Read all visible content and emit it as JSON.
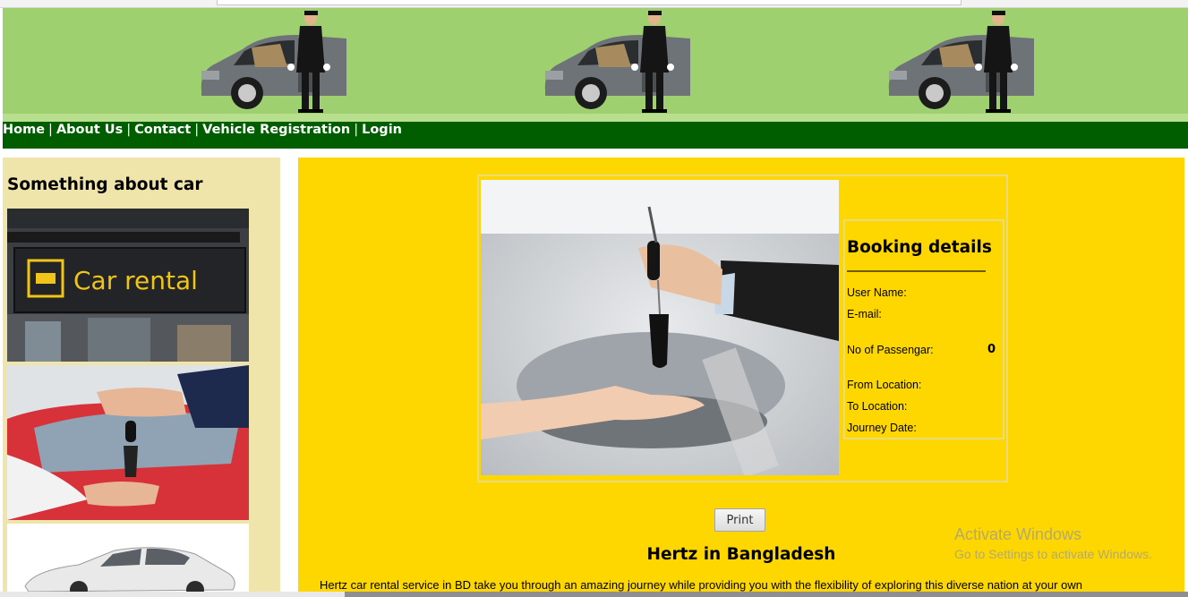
{
  "nav": {
    "items": [
      {
        "label": "Home"
      },
      {
        "label": "About Us"
      },
      {
        "label": "Contact"
      },
      {
        "label": "Vehicle Registration"
      },
      {
        "label": "Login"
      }
    ],
    "separator": "|"
  },
  "sidebar": {
    "title": "Something about car",
    "sign_text": "Car rental"
  },
  "booking": {
    "title": "Booking details",
    "fields": [
      {
        "label": "User Name:",
        "value": ""
      },
      {
        "label": "E-mail:",
        "value": ""
      },
      {
        "label": "No of Passengar:",
        "value": "0"
      },
      {
        "label": "From Location:",
        "value": ""
      },
      {
        "label": "To Location:",
        "value": ""
      },
      {
        "label": "Journey Date:",
        "value": ""
      }
    ]
  },
  "print_label": "Print",
  "section": {
    "heading": "Hertz in Bangladesh",
    "text": "Hertz car rental service in BD take you through an amazing journey while providing you with the flexibility of exploring this diverse nation at your own"
  },
  "watermark": {
    "line1": "Activate Windows",
    "line2": "Go to Settings to activate Windows."
  },
  "colors": {
    "banner": "#9fd070",
    "nav_bg": "#005e00",
    "sidebar_bg": "#efe5aa",
    "main_bg": "#ffd700"
  }
}
